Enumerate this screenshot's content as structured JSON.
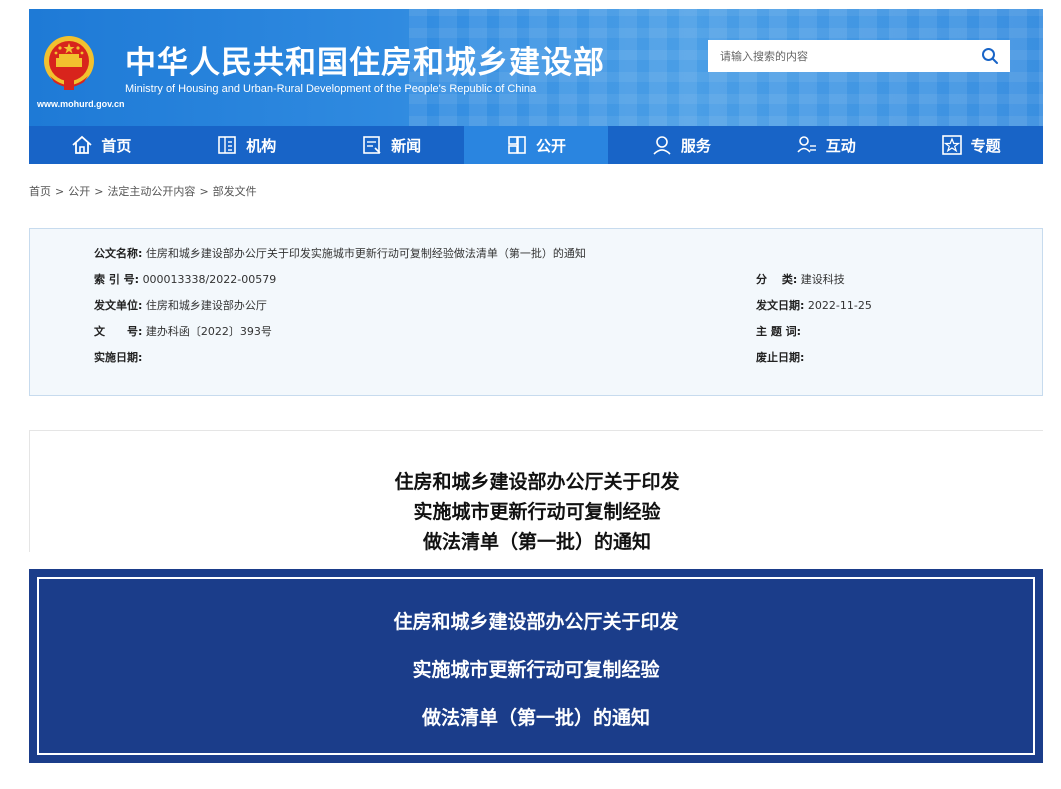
{
  "header": {
    "title": "中华人民共和国住房和城乡建设部",
    "subtitle": "Ministry of Housing and Urban-Rural Development of the People's Republic of China",
    "url": "www.mohurd.gov.cn",
    "search_placeholder": "请输入搜索的内容"
  },
  "nav": {
    "items": [
      {
        "label": "首页",
        "icon": "home-icon"
      },
      {
        "label": "机构",
        "icon": "building-icon"
      },
      {
        "label": "新闻",
        "icon": "news-icon"
      },
      {
        "label": "公开",
        "icon": "disclosure-icon",
        "active": true
      },
      {
        "label": "服务",
        "icon": "service-icon"
      },
      {
        "label": "互动",
        "icon": "interaction-icon"
      },
      {
        "label": "专题",
        "icon": "star-box-icon"
      }
    ]
  },
  "breadcrumb": [
    "首页",
    "公开",
    "法定主动公开内容",
    "部发文件"
  ],
  "info": {
    "doc_name_label": "公文名称:",
    "doc_name": "住房和城乡建设部办公厅关于印发实施城市更新行动可复制经验做法清单（第一批）的通知",
    "index_label": "索 引 号:",
    "index": "000013338/2022-00579",
    "category_label": "分　 类:",
    "category": "建设科技",
    "issuer_label": "发文单位:",
    "issuer": "住房和城乡建设部办公厅",
    "issue_date_label": "发文日期:",
    "issue_date": "2022-11-25",
    "doc_no_label": "文　　号:",
    "doc_no": "建办科函〔2022〕393号",
    "keywords_label": "主 题 词:",
    "keywords": "",
    "effective_label": "实施日期:",
    "effective": "",
    "expiry_label": "废止日期:",
    "expiry": ""
  },
  "article": {
    "title_lines": [
      "住房和城乡建设部办公厅关于印发",
      "实施城市更新行动可复制经验",
      "做法清单（第一批）的通知"
    ]
  },
  "banner": {
    "lines": [
      "住房和城乡建设部办公厅关于印发",
      "实施城市更新行动可复制经验",
      "做法清单（第一批）的通知"
    ]
  },
  "colors": {
    "header_blue": "#2f8ae0",
    "nav_blue": "#1864c7",
    "nav_active": "#2a85e0",
    "banner_navy": "#1b3d8a",
    "emblem_red": "#d8241c",
    "emblem_gold": "#f2c12e"
  }
}
